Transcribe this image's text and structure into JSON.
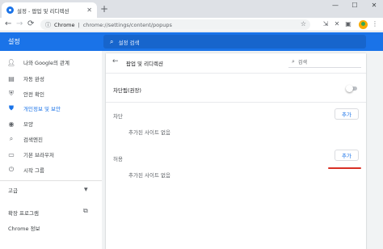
{
  "browser": {
    "tab_title": "설정 - 팝업 및 리디렉션",
    "tab_close": "✕",
    "new_tab": "+",
    "window_controls": [
      "—",
      "☐",
      "✕"
    ],
    "omnibox": {
      "site": "Chrome",
      "separator": "|",
      "path": "chrome://settings/content/popups"
    },
    "nav": {
      "back": "←",
      "forward": "→",
      "reload": "⟳"
    }
  },
  "header": {
    "title": "설정",
    "search_placeholder": "설정 검색"
  },
  "sidebar": {
    "items": [
      {
        "label": "나와 Google의 관계",
        "icon": "person-icon"
      },
      {
        "label": "자동 완성",
        "icon": "clipboard-icon"
      },
      {
        "label": "안전 확인",
        "icon": "shield-check-icon"
      },
      {
        "label": "개인정보 및 보안",
        "icon": "shield-icon",
        "active": true
      },
      {
        "label": "모양",
        "icon": "palette-icon"
      },
      {
        "label": "검색엔진",
        "icon": "search-icon"
      },
      {
        "label": "기본 브라우저",
        "icon": "browser-icon"
      },
      {
        "label": "시작 그룹",
        "icon": "power-icon"
      }
    ],
    "advanced": "고급",
    "extensions": "확장 프로그램",
    "about": "Chrome 정보"
  },
  "main": {
    "page_title": "팝업 및 리디렉션",
    "search_placeholder": "검색",
    "blocked_toggle_label": "차단됨(권장)",
    "blocked_toggle_on": false,
    "block_section": {
      "label": "차단",
      "add_button": "추가",
      "empty_text": "추가된 사이트 없음"
    },
    "allow_section": {
      "label": "허용",
      "add_button": "추가",
      "empty_text": "추가된 사이트 없음"
    }
  },
  "colors": {
    "accent": "#1a73e8",
    "highlight_underline": "#d93025"
  }
}
